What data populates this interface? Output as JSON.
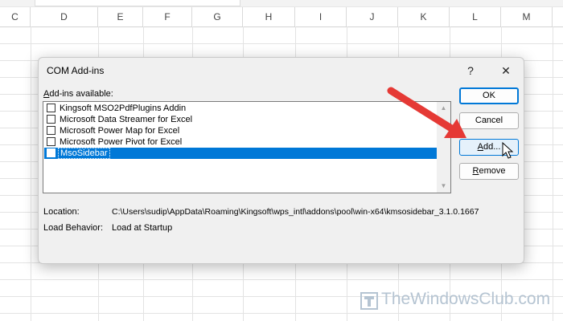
{
  "sheet": {
    "columns": [
      "C",
      "D",
      "E",
      "F",
      "G",
      "H",
      "I",
      "J",
      "K",
      "L",
      "M"
    ]
  },
  "dialog": {
    "title": "COM Add-ins",
    "help_glyph": "?",
    "close_glyph": "✕",
    "addins_label": "Add-ins available:",
    "addins_label_accel": "A",
    "addins_label_rest": "dd-ins available:",
    "items": [
      {
        "label": "Kingsoft MSO2PdfPlugins Addin",
        "checked": false,
        "selected": false
      },
      {
        "label": "Microsoft Data Streamer for Excel",
        "checked": false,
        "selected": false
      },
      {
        "label": "Microsoft Power Map for Excel",
        "checked": false,
        "selected": false
      },
      {
        "label": "Microsoft Power Pivot for Excel",
        "checked": false,
        "selected": false
      },
      {
        "label": "MsoSidebar",
        "checked": false,
        "selected": true
      }
    ],
    "buttons": {
      "ok": "OK",
      "cancel": "Cancel",
      "add_accel": "A",
      "add_rest": "dd...",
      "remove_accel": "R",
      "remove_rest": "emove"
    },
    "location_label": "Location:",
    "location_value": "C:\\Users\\sudip\\AppData\\Roaming\\Kingsoft\\wps_intl\\addons\\pool\\win-x64\\kmsosidebar_3.1.0.1667",
    "behavior_label": "Load Behavior:",
    "behavior_value": "Load at Startup"
  },
  "watermark": {
    "text": "TheWindowsClub.com"
  },
  "colors": {
    "selection": "#0078d7",
    "annotation_arrow": "#e53935",
    "dialog_bg": "#f0f0f0"
  }
}
